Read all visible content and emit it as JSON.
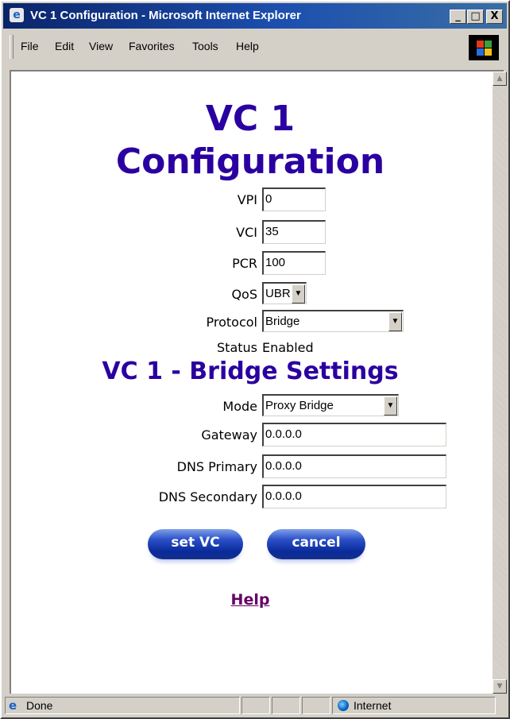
{
  "window": {
    "title": "VC 1 Configuration - Microsoft Internet Explorer",
    "controls": [
      "_",
      "□",
      "X"
    ]
  },
  "menu": {
    "items": [
      {
        "label": "File"
      },
      {
        "label": "Edit"
      },
      {
        "label": "View"
      },
      {
        "label": "Favorites"
      },
      {
        "label": "Tools"
      },
      {
        "label": "Help"
      }
    ]
  },
  "page": {
    "heading_line1": "VC 1",
    "heading_line2": "Configuration",
    "fields": {
      "vpi": {
        "label": "VPI",
        "value": "0"
      },
      "vci": {
        "label": "VCI",
        "value": "35"
      },
      "pcr": {
        "label": "PCR",
        "value": "100"
      },
      "qos": {
        "label": "QoS",
        "value": "UBR"
      },
      "protocol": {
        "label": "Protocol",
        "value": "Bridge"
      },
      "status": {
        "label": "Status",
        "value": "Enabled"
      }
    },
    "bridge_heading": "VC 1 - Bridge Settings",
    "bridge": {
      "mode": {
        "label": "Mode",
        "value": "Proxy Bridge"
      },
      "gateway": {
        "label": "Gateway",
        "value": "0.0.0.0"
      },
      "dns_primary": {
        "label": "DNS Primary",
        "value": "0.0.0.0"
      },
      "dns_secondary": {
        "label": "DNS Secondary",
        "value": "0.0.0.0"
      }
    },
    "buttons": {
      "set_vc": "set VC",
      "cancel": "cancel"
    },
    "help_link": "Help"
  },
  "statusbar": {
    "text": "Done",
    "zone": "Internet"
  },
  "colors": {
    "heading": "#2a00a0",
    "link_visited": "#660066",
    "titlebar": "#0a246a",
    "button": "#0a2a9a"
  }
}
